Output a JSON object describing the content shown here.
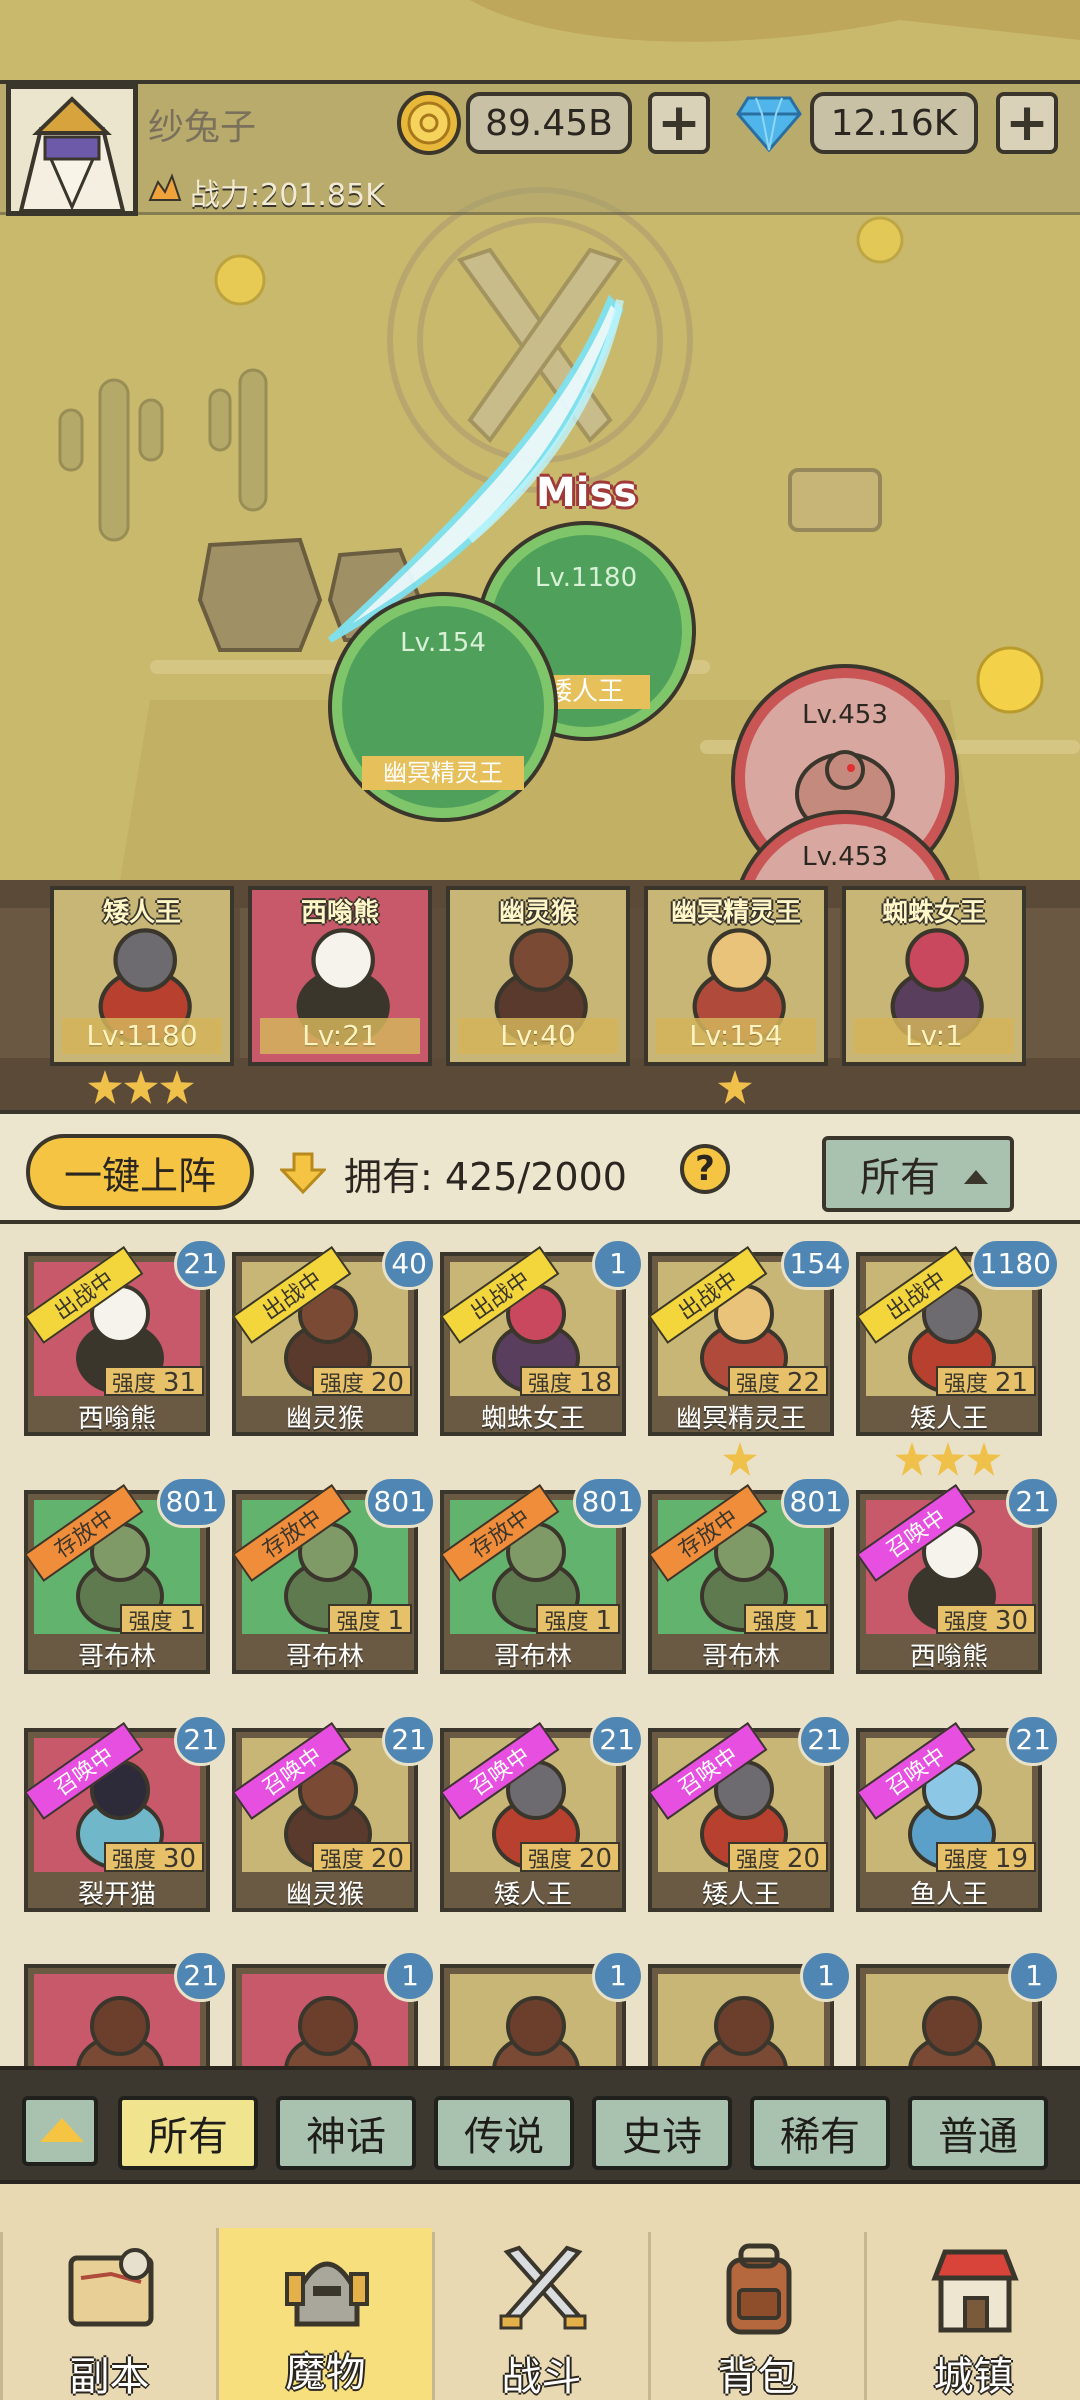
{
  "player": {
    "name": "纱兔子",
    "power_text": "战力:201.85K",
    "gold": "89.45B",
    "gems": "12.16K",
    "add_label": "+"
  },
  "battle": {
    "miss_text": "Miss",
    "allies": [
      {
        "level": "Lv.1180",
        "name": "矮人王"
      },
      {
        "level": "Lv.154",
        "name": "幽冥精灵王"
      }
    ],
    "enemies": [
      {
        "level": "Lv.453"
      },
      {
        "level": "Lv.453"
      }
    ]
  },
  "team": [
    {
      "name": "矮人王",
      "level": "Lv:1180",
      "stars": 3
    },
    {
      "name": "西嗡熊",
      "level": "Lv:21",
      "stars": 0
    },
    {
      "name": "幽灵猴",
      "level": "Lv:40",
      "stars": 0
    },
    {
      "name": "幽冥精灵王",
      "level": "Lv:154",
      "stars": 1
    },
    {
      "name": "蜘蛛女王",
      "level": "Lv:1",
      "stars": 0
    }
  ],
  "roster": {
    "deploy_label": "一键上阵",
    "owned_label": "拥有:",
    "owned_count": "425/2000",
    "help_label": "?",
    "filter_label": "所有",
    "strength_label": "强度",
    "monsters": [
      {
        "name": "西嗡熊",
        "tag": "出战中",
        "tag_type": "fight",
        "level": "21",
        "strength": "31",
        "color": "#c7596b",
        "stars": 0
      },
      {
        "name": "幽灵猴",
        "tag": "出战中",
        "tag_type": "fight",
        "level": "40",
        "strength": "20",
        "color": "#c7b675",
        "stars": 0
      },
      {
        "name": "蜘蛛女王",
        "tag": "出战中",
        "tag_type": "fight",
        "level": "1",
        "strength": "18",
        "color": "#c7b675",
        "stars": 0
      },
      {
        "name": "幽冥精灵王",
        "tag": "出战中",
        "tag_type": "fight",
        "level": "154",
        "strength": "22",
        "color": "#c7b675",
        "stars": 1
      },
      {
        "name": "矮人王",
        "tag": "出战中",
        "tag_type": "fight",
        "level": "1180",
        "strength": "21",
        "color": "#c7b675",
        "stars": 3
      },
      {
        "name": "哥布林",
        "tag": "存放中",
        "tag_type": "store",
        "level": "801",
        "strength": "1",
        "color": "#62b36e",
        "stars": 0
      },
      {
        "name": "哥布林",
        "tag": "存放中",
        "tag_type": "store",
        "level": "801",
        "strength": "1",
        "color": "#62b36e",
        "stars": 0
      },
      {
        "name": "哥布林",
        "tag": "存放中",
        "tag_type": "store",
        "level": "801",
        "strength": "1",
        "color": "#62b36e",
        "stars": 0
      },
      {
        "name": "哥布林",
        "tag": "存放中",
        "tag_type": "store",
        "level": "801",
        "strength": "1",
        "color": "#62b36e",
        "stars": 0
      },
      {
        "name": "西嗡熊",
        "tag": "召唤中",
        "tag_type": "summon",
        "level": "21",
        "strength": "30",
        "color": "#c7596b",
        "stars": 0
      },
      {
        "name": "裂开猫",
        "tag": "召唤中",
        "tag_type": "summon",
        "level": "21",
        "strength": "30",
        "color": "#c7596b",
        "stars": 0
      },
      {
        "name": "幽灵猴",
        "tag": "召唤中",
        "tag_type": "summon",
        "level": "21",
        "strength": "20",
        "color": "#c7b675",
        "stars": 0
      },
      {
        "name": "矮人王",
        "tag": "召唤中",
        "tag_type": "summon",
        "level": "21",
        "strength": "20",
        "color": "#c7b675",
        "stars": 0
      },
      {
        "name": "矮人王",
        "tag": "召唤中",
        "tag_type": "summon",
        "level": "21",
        "strength": "20",
        "color": "#c7b675",
        "stars": 0
      },
      {
        "name": "鱼人王",
        "tag": "召唤中",
        "tag_type": "summon",
        "level": "21",
        "strength": "19",
        "color": "#c7b675",
        "stars": 0
      },
      {
        "name": "",
        "tag": "",
        "tag_type": "",
        "level": "21",
        "strength": "",
        "color": "#c7596b",
        "stars": 0
      },
      {
        "name": "",
        "tag": "",
        "tag_type": "",
        "level": "1",
        "strength": "",
        "color": "#c7596b",
        "stars": 0
      },
      {
        "name": "",
        "tag": "",
        "tag_type": "",
        "level": "1",
        "strength": "",
        "color": "#c7b675",
        "stars": 0
      },
      {
        "name": "",
        "tag": "",
        "tag_type": "",
        "level": "1",
        "strength": "",
        "color": "#c7b675",
        "stars": 0
      },
      {
        "name": "",
        "tag": "",
        "tag_type": "",
        "level": "1",
        "strength": "",
        "color": "#c7b675",
        "stars": 0
      }
    ]
  },
  "rarity_filters": [
    {
      "label": "所有",
      "active": true
    },
    {
      "label": "神话",
      "active": false
    },
    {
      "label": "传说",
      "active": false
    },
    {
      "label": "史诗",
      "active": false
    },
    {
      "label": "稀有",
      "active": false
    },
    {
      "label": "普通",
      "active": false
    }
  ],
  "nav": [
    {
      "label": "副本",
      "icon": "map-scroll-icon",
      "active": false
    },
    {
      "label": "魔物",
      "icon": "knight-helmet-icon",
      "active": true
    },
    {
      "label": "战斗",
      "icon": "crossed-swords-icon",
      "active": false
    },
    {
      "label": "背包",
      "icon": "backpack-icon",
      "active": false
    },
    {
      "label": "城镇",
      "icon": "shop-house-icon",
      "active": false
    }
  ]
}
